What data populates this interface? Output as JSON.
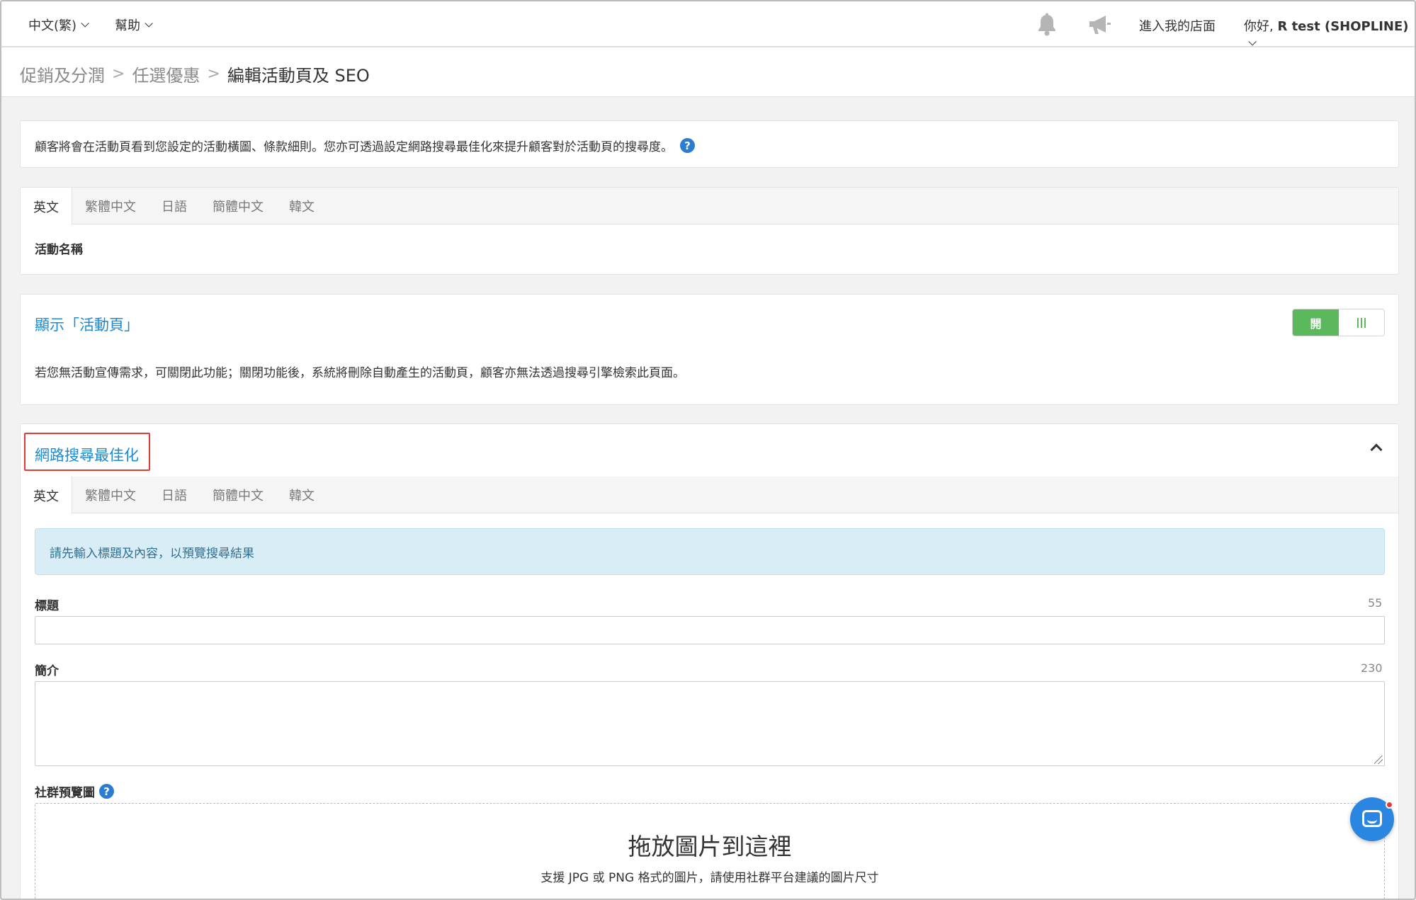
{
  "topbar": {
    "language": "中文(繁)",
    "help": "幫助",
    "store_link": "進入我的店面",
    "greeting": "你好, ",
    "user_name": "R test (SHOPLINE)"
  },
  "breadcrumb": {
    "items": [
      "促銷及分潤",
      "任選優惠"
    ],
    "current": "編輯活動頁及 SEO",
    "separator": ">"
  },
  "info": {
    "text": "顧客將會在活動頁看到您設定的活動橫圖、條款細則。您亦可透過設定網路搜尋最佳化來提升顧客對於活動頁的搜尋度。"
  },
  "language_tabs": [
    "英文",
    "繁體中文",
    "日語",
    "簡體中文",
    "韓文"
  ],
  "name_section": {
    "label": "活動名稱"
  },
  "display_section": {
    "title": "顯示「活動頁」",
    "toggle_on_label": "開",
    "toggle_state": "on",
    "description": "若您無活動宣傳需求，可關閉此功能；關閉功能後，系統將刪除自動產生的活動頁，顧客亦無法透過搜尋引擎檢索此頁面。"
  },
  "seo_section": {
    "title": "網路搜尋最佳化",
    "alert": "請先輸入標題及內容，以預覽搜尋結果",
    "title_field": {
      "label": "標題",
      "counter": "55",
      "value": ""
    },
    "intro_field": {
      "label": "簡介",
      "counter": "230",
      "value": ""
    },
    "social_preview": {
      "label": "社群預覽圖",
      "drop_title": "拖放圖片到這裡",
      "drop_subtitle": "支援 JPG 或 PNG 格式的圖片，請使用社群平台建議的圖片尺寸"
    }
  },
  "colors": {
    "accent_blue": "#1a8ad4",
    "toggle_green": "#5cb85c",
    "highlight_red": "#e53935",
    "alert_bg": "#d9edf7",
    "chat_blue": "#2a86e0"
  },
  "icons": [
    "bell-icon",
    "megaphone-icon",
    "help-icon",
    "collapse-icon",
    "chat-icon"
  ]
}
